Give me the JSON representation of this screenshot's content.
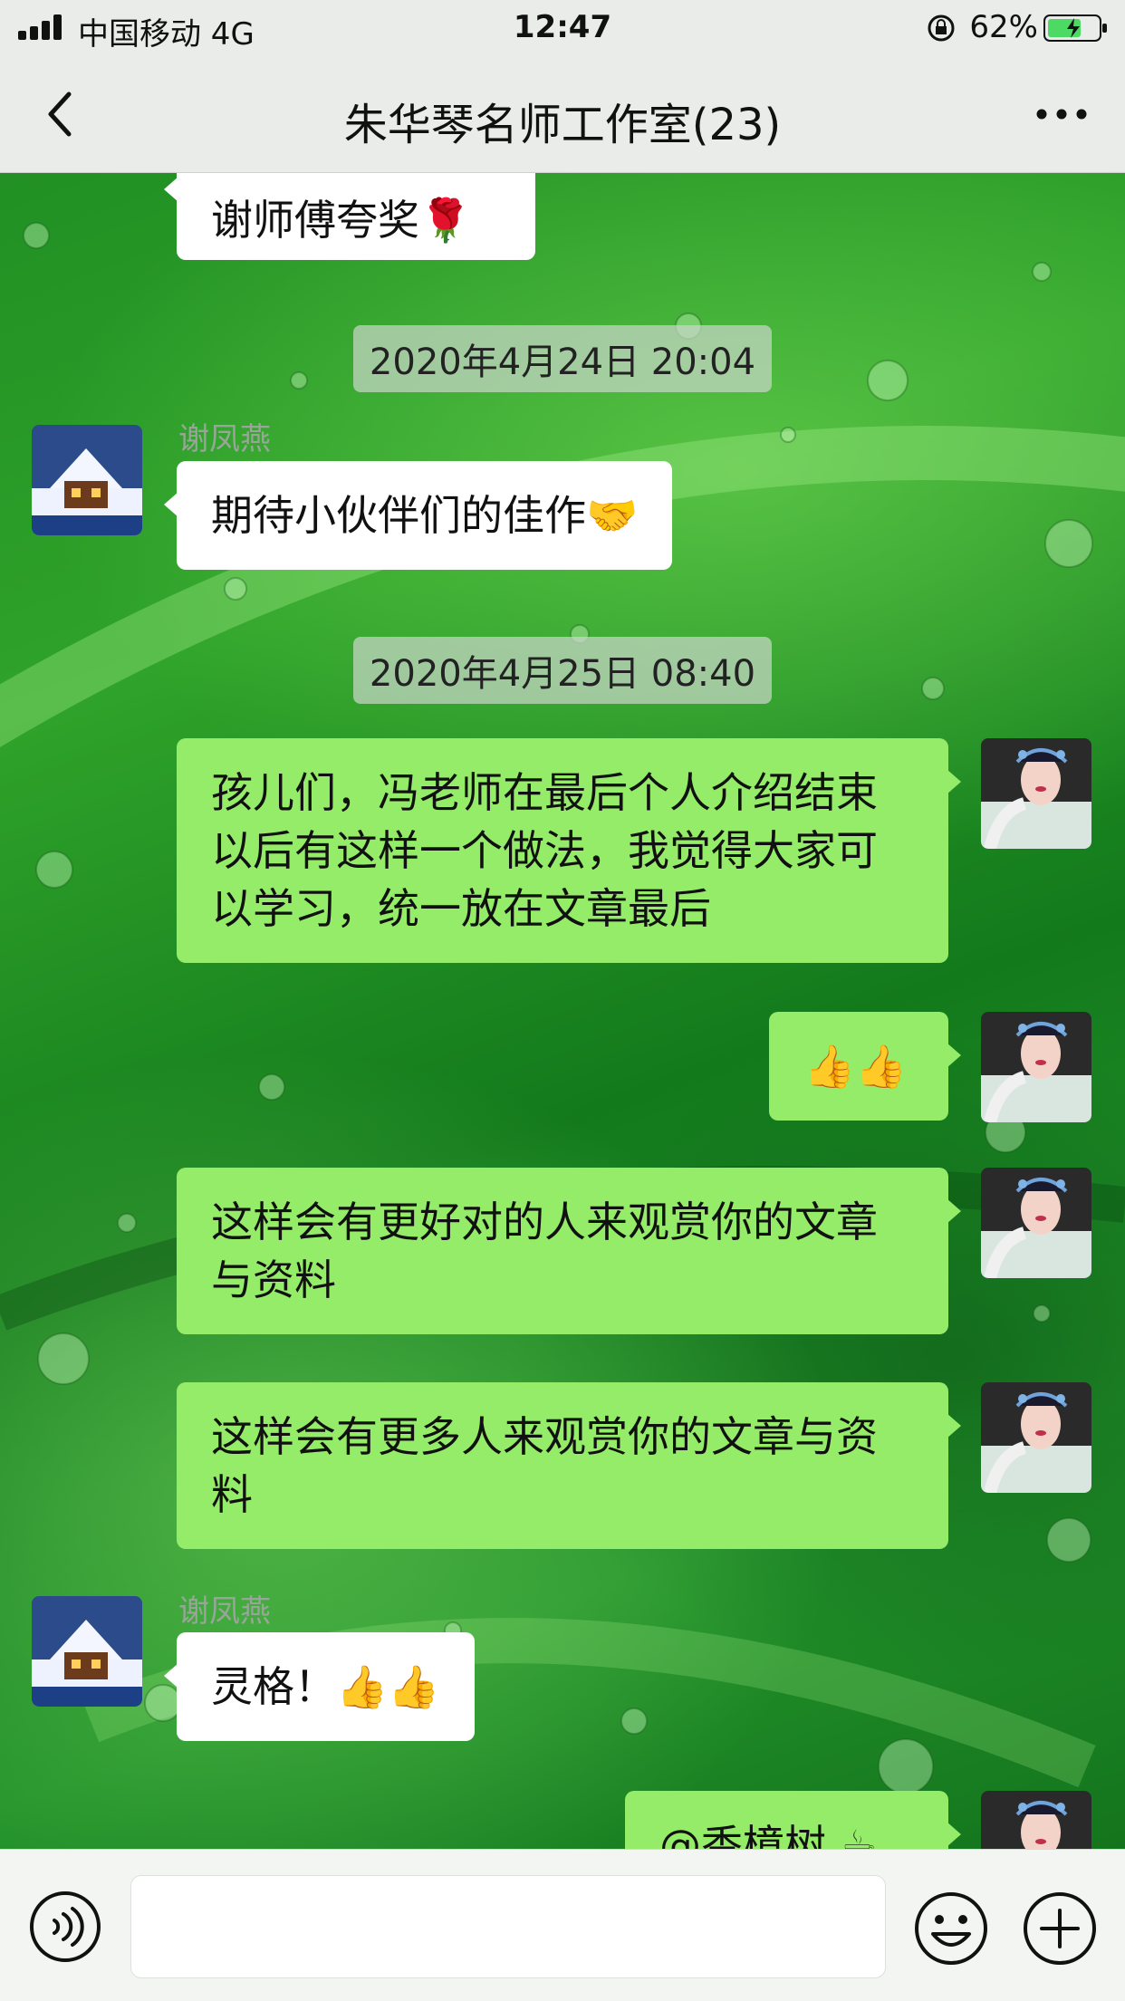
{
  "status_bar": {
    "carrier": "中国移动 4G",
    "time": "12:47",
    "battery": "62%"
  },
  "nav": {
    "title": "朱华琴名师工作室(23)"
  },
  "messages": [
    {
      "id": "m0",
      "side": "in",
      "text": "谢师傅夸奖🌹"
    },
    {
      "id": "t1",
      "timestamp": "2020年4月24日 20:04"
    },
    {
      "id": "m1",
      "side": "in",
      "sender": "谢凤燕",
      "text": "期待小伙伴们的佳作🤝"
    },
    {
      "id": "t2",
      "timestamp": "2020年4月25日 08:40"
    },
    {
      "id": "m2",
      "side": "out",
      "text": "孩儿们，冯老师在最后个人介绍结束以后有这样一个做法，我觉得大家可以学习，统一放在文章最后"
    },
    {
      "id": "m3",
      "side": "out",
      "text": "👍👍"
    },
    {
      "id": "m4",
      "side": "out",
      "text": "这样会有更好对的人来观赏你的文章与资料"
    },
    {
      "id": "m5",
      "side": "out",
      "text": "这样会有更多人来观赏你的文章与资料"
    },
    {
      "id": "m6",
      "side": "in",
      "sender": "谢凤燕",
      "text": "灵格！👍👍"
    },
    {
      "id": "m7",
      "side": "out",
      "text": "@香樟树 ☕"
    }
  ],
  "colors": {
    "incoming_bubble": "#ffffff",
    "outgoing_bubble": "#95ec69",
    "topbar": "#e9ece9"
  },
  "icons": {
    "back": "chevron-left-icon",
    "more": "more-dots-icon",
    "voice": "voice-icon",
    "emoji": "smiley-icon",
    "plus": "plus-circle-icon"
  }
}
